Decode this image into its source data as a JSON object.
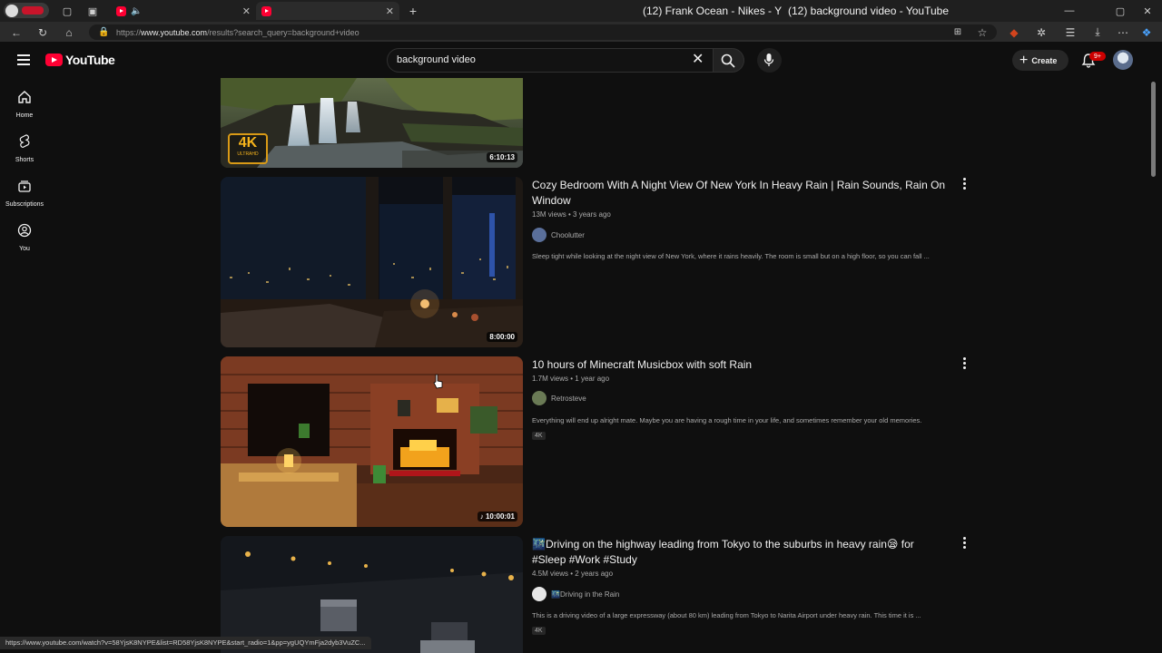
{
  "browser": {
    "tabs": [
      {
        "title": "(12) Frank Ocean - Nikes - Y",
        "audio": true
      },
      {
        "title": "(12) background video - YouTube",
        "active": true
      }
    ],
    "new_tab_label": "+",
    "close_glyph": "✕",
    "url_prefix": "https://",
    "url_domain": "www.youtube.com",
    "url_path": "/results?search_query=background+video"
  },
  "header": {
    "logo_text": "YouTube",
    "search_value": "background video",
    "search_placeholder": "Search",
    "create_label": "Create",
    "notifications_badge": "9+"
  },
  "guide": [
    {
      "label": "Home",
      "icon": "home-icon"
    },
    {
      "label": "Shorts",
      "icon": "shorts-icon"
    },
    {
      "label": "Subscriptions",
      "icon": "subscriptions-icon"
    },
    {
      "label": "You",
      "icon": "you-icon"
    }
  ],
  "results": [
    {
      "duration": "6:10:13",
      "badge": "4K",
      "badge_sub": "ULTRAHD"
    },
    {
      "title": "Cozy Bedroom With A Night View Of New York In Heavy Rain | Rain Sounds, Rain On Window",
      "views": "13M views",
      "age": "3 years ago",
      "channel": "Choolutter",
      "description": "Sleep tight while looking at the night view of New York, where it rains heavily. The room is small but on a high floor, so you can fall ...",
      "duration": "8:00:00"
    },
    {
      "title": "10 hours of Minecraft Musicbox with soft Rain",
      "views": "1.7M views",
      "age": "1 year ago",
      "channel": "Retrosteve",
      "description": "Everything will end up alright mate. Maybe you are having a rough time in your life, and sometimes remember your old memories.",
      "tag": "4K",
      "duration": "10:00:01"
    },
    {
      "title": "🌃Driving on the highway leading from Tokyo to the suburbs in heavy rain😪 for #Sleep #Work #Study",
      "views": "4.5M views",
      "age": "2 years ago",
      "channel": "🌃Driving in the Rain",
      "description": "This is a driving video of a large expressway (about 80 km) leading from Tokyo to Narita Airport under heavy rain. This time it is ...",
      "tag": "4K"
    }
  ],
  "meta_separator": " • ",
  "status_url": "https://www.youtube.com/watch?v=58YjsK8NYPE&list=RD58YjsK8NYPE&start_radio=1&pp=ygUQYmFja2dyb3VuZC..."
}
